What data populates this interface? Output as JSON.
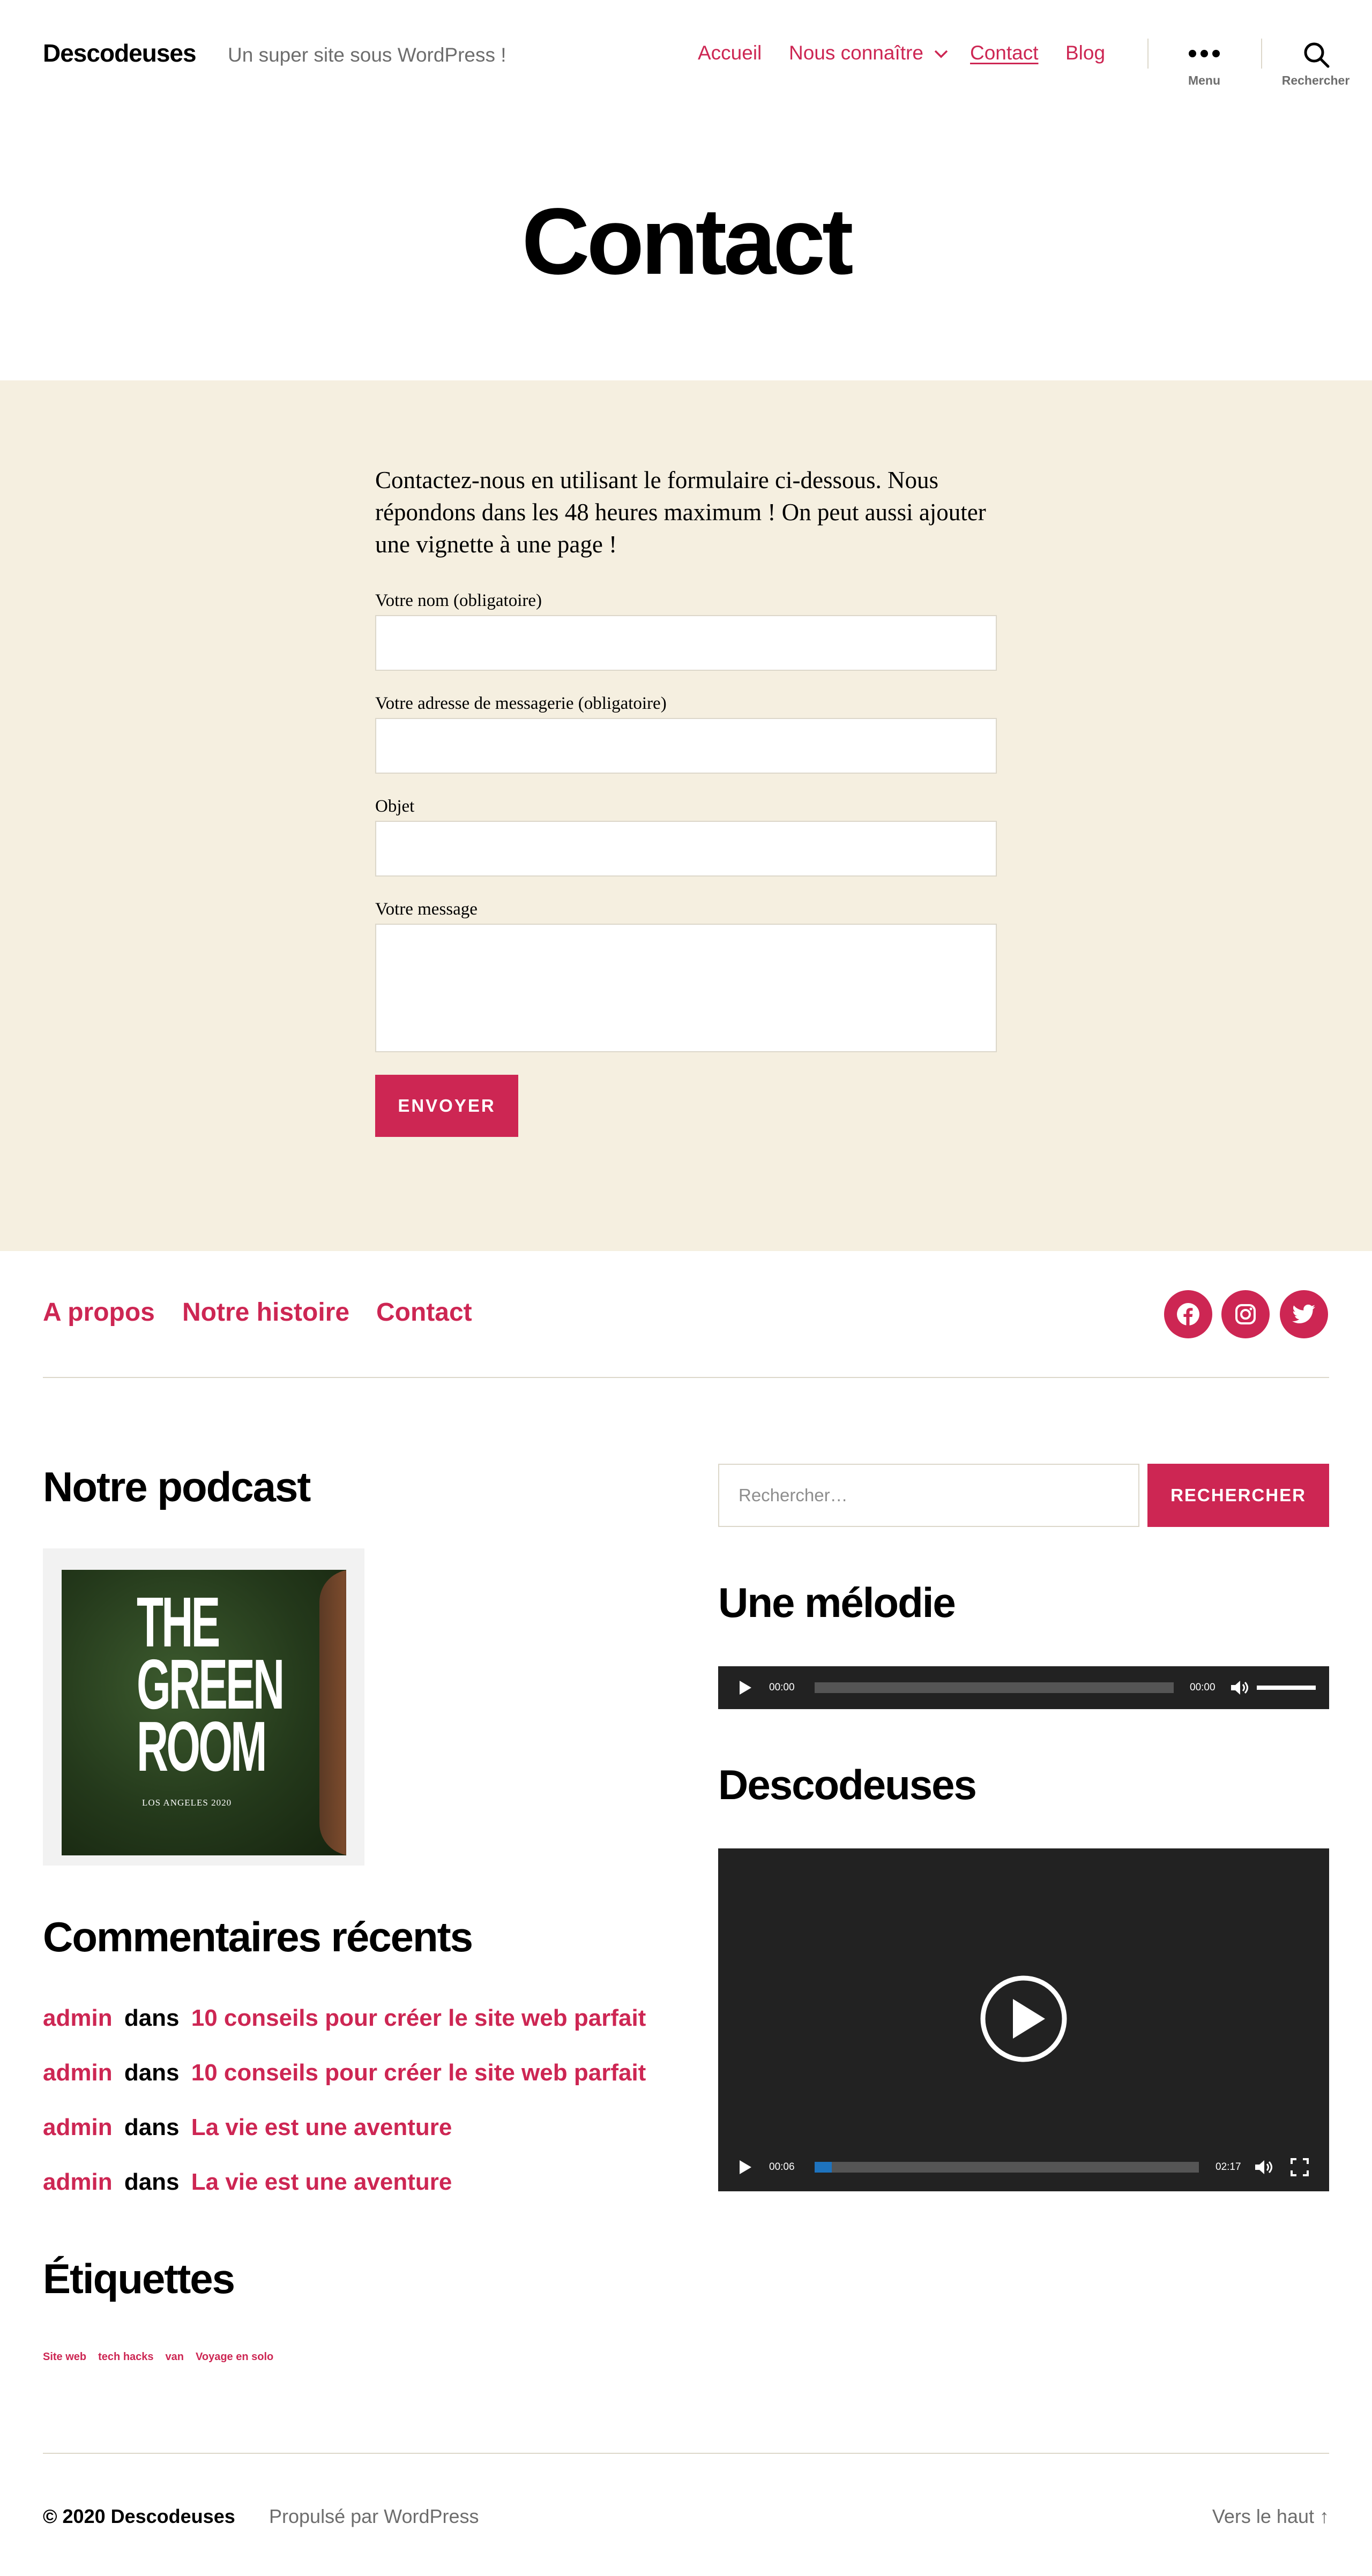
{
  "header": {
    "site_title": "Descodeuses",
    "site_description": "Un super site sous WordPress !",
    "nav": [
      {
        "label": "Accueil"
      },
      {
        "label": "Nous connaître"
      },
      {
        "label": "Contact"
      },
      {
        "label": "Blog"
      }
    ],
    "menu_label": "Menu",
    "search_label": "Rechercher"
  },
  "page": {
    "title": "Contact",
    "intro": "Contactez-nous en utilisant le formulaire ci-dessous. Nous répondons dans les 48 heures maximum ! On peut aussi ajouter une vignette à une page !"
  },
  "form": {
    "name_label": "Votre nom (obligatoire)",
    "email_label": "Votre adresse de messagerie (obligatoire)",
    "subject_label": "Objet",
    "message_label": "Votre message",
    "name_value": "",
    "email_value": "",
    "subject_value": "",
    "message_value": "",
    "submit_label": "ENVOYER"
  },
  "footer_nav": [
    {
      "label": "A propos"
    },
    {
      "label": "Notre histoire"
    },
    {
      "label": "Contact"
    }
  ],
  "social": [
    "facebook-icon",
    "instagram-icon",
    "twitter-icon"
  ],
  "widgets": {
    "podcast_title": "Notre podcast",
    "podcast_cover": {
      "title": "THE GREEN ROOM",
      "subtitle": "LOS ANGELES 2020"
    },
    "comments_title": "Commentaires récents",
    "comments": [
      {
        "author": "admin",
        "sep": "dans",
        "post": "10 conseils pour créer le site web parfait"
      },
      {
        "author": "admin",
        "sep": "dans",
        "post": "10 conseils pour créer le site web parfait"
      },
      {
        "author": "admin",
        "sep": "dans",
        "post": "La vie est une aventure"
      },
      {
        "author": "admin",
        "sep": "dans",
        "post": "La vie est une aventure"
      }
    ],
    "tags_title": "Étiquettes",
    "tags": [
      "Site web",
      "tech hacks",
      "van",
      "Voyage en solo"
    ],
    "search_placeholder": "Rechercher…",
    "search_button": "RECHERCHER",
    "melody_title": "Une mélodie",
    "audio": {
      "current": "00:00",
      "duration": "00:00"
    },
    "video_title": "Descodeuses",
    "video": {
      "current": "00:06",
      "duration": "02:17",
      "progress": 0.045
    }
  },
  "colors": {
    "accent": "#cd2653",
    "content_bg": "#f5efe0",
    "player": "#222222"
  },
  "bottom": {
    "copyright": "© 2020 Descodeuses",
    "powered": "Propulsé par WordPress",
    "to_top": "Vers le haut ↑"
  }
}
